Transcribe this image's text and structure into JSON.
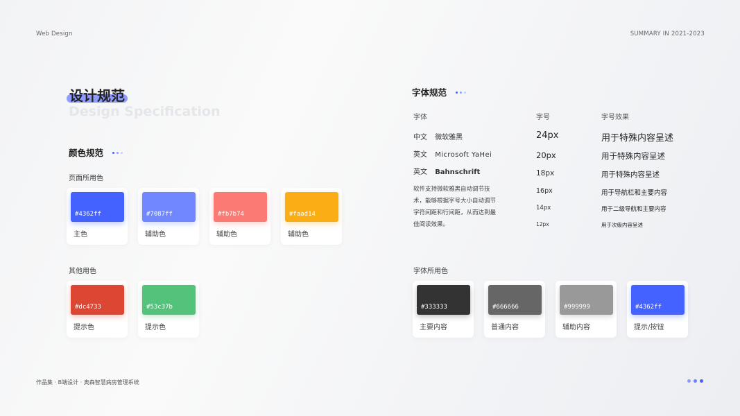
{
  "header": {
    "left": "Web Design",
    "right": "SUMMARY IN 2021-2023"
  },
  "title": {
    "cn": "设计规范",
    "en": "Design Specification"
  },
  "color_section": {
    "title": "颜色规范",
    "page_colors_label": "页面所用色",
    "page_colors": [
      {
        "hex": "#4362ff",
        "label": "主色"
      },
      {
        "hex": "#7087ff",
        "label": "辅助色"
      },
      {
        "hex": "#fb7b74",
        "label": "辅助色"
      },
      {
        "hex": "#faad14",
        "label": "辅助色"
      }
    ],
    "other_colors_label": "其他用色",
    "other_colors": [
      {
        "hex": "#dc4733",
        "label": "提示色"
      },
      {
        "hex": "#53c37b",
        "label": "提示色"
      }
    ]
  },
  "font_section": {
    "title": "字体规范",
    "col_font": "字体",
    "col_size": "字号",
    "col_effect": "字号效果",
    "fonts": [
      {
        "lang": "中文",
        "name": "微软雅黑"
      },
      {
        "lang": "英文",
        "name": "Microsoft YaHei"
      },
      {
        "lang": "英文",
        "name": "Bahnschrift"
      }
    ],
    "description": "软件支持微软雅黑自动调节技术，能够根据字号大小自动调节字符间距和行间距，从而达到最佳阅读效果。",
    "sizes": [
      {
        "size": "24px",
        "effect": "用于特殊内容呈述"
      },
      {
        "size": "20px",
        "effect": "用于特殊内容呈述"
      },
      {
        "size": "18px",
        "effect": "用于特殊内容呈述"
      },
      {
        "size": "16px",
        "effect": "用于导航栏和主要内容"
      },
      {
        "size": "14px",
        "effect": "用于二级导航和主要内容"
      },
      {
        "size": "12px",
        "effect": "用于次级内容呈述"
      }
    ],
    "font_colors_label": "字体所用色",
    "font_colors": [
      {
        "hex": "#333333",
        "label": "主要内容"
      },
      {
        "hex": "#666666",
        "label": "普通内容"
      },
      {
        "hex": "#999999",
        "label": "辅助内容"
      },
      {
        "hex": "#4362ff",
        "label": "提示/按钮"
      }
    ]
  },
  "footer": {
    "text": "作品集 · B端设计 · 奥森智慧病房管理系统"
  },
  "accent": "#4362ff"
}
